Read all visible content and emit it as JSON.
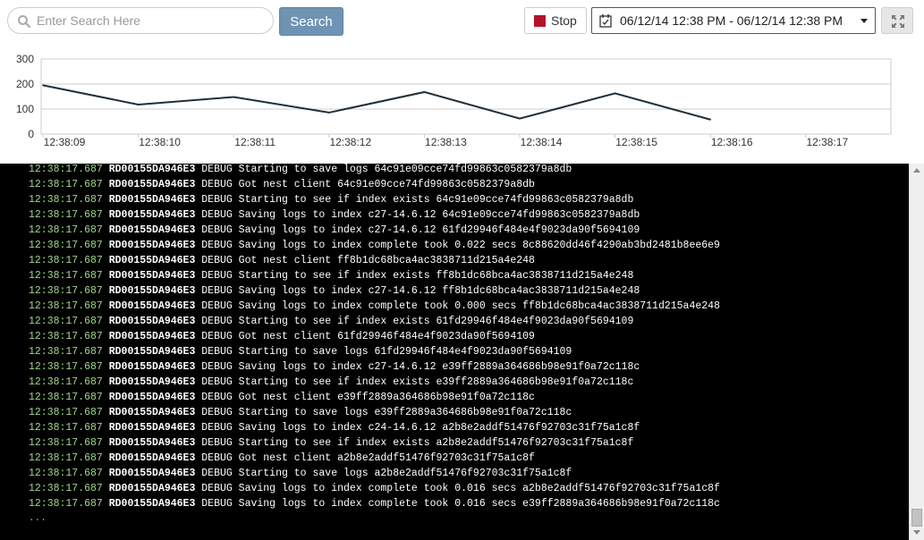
{
  "toolbar": {
    "search_placeholder": "Enter Search Here",
    "search_value": "",
    "search_button_label": "Search",
    "stop_button_label": "Stop",
    "date_range": "06/12/14 12:38 PM - 06/12/14 12:38 PM"
  },
  "colors": {
    "search_button": "#6f93b3",
    "stop_square": "#b5132b",
    "line": "#1f2f3a",
    "timestamp": "#9fd58a",
    "console_bg": "#000000"
  },
  "chart_data": {
    "type": "line",
    "x": [
      "12:38:09",
      "12:38:10",
      "12:38:11",
      "12:38:12",
      "12:38:13",
      "12:38:14",
      "12:38:15",
      "12:38:16"
    ],
    "x_ticks": [
      "12:38:09",
      "12:38:10",
      "12:38:11",
      "12:38:12",
      "12:38:13",
      "12:38:14",
      "12:38:15",
      "12:38:16",
      "12:38:17"
    ],
    "values": [
      195,
      118,
      148,
      86,
      168,
      62,
      163,
      58
    ],
    "ylim": [
      0,
      300
    ],
    "y_ticks": [
      0,
      100,
      200,
      300
    ],
    "grid": true
  },
  "logs": [
    {
      "ts": "12:38:17.687",
      "host": "RD00155DA946E3",
      "msg": "DEBUG Starting to save logs 64c91e09cce74fd99863c0582379a8db"
    },
    {
      "ts": "12:38:17.687",
      "host": "RD00155DA946E3",
      "msg": "DEBUG Got nest client 64c91e09cce74fd99863c0582379a8db"
    },
    {
      "ts": "12:38:17.687",
      "host": "RD00155DA946E3",
      "msg": "DEBUG Starting to see if index exists 64c91e09cce74fd99863c0582379a8db"
    },
    {
      "ts": "12:38:17.687",
      "host": "RD00155DA946E3",
      "msg": "DEBUG Saving logs to index c27-14.6.12 64c91e09cce74fd99863c0582379a8db"
    },
    {
      "ts": "12:38:17.687",
      "host": "RD00155DA946E3",
      "msg": "DEBUG Saving logs to index c27-14.6.12 61fd29946f484e4f9023da90f5694109"
    },
    {
      "ts": "12:38:17.687",
      "host": "RD00155DA946E3",
      "msg": "DEBUG Saving logs to index complete took 0.022 secs 8c88620dd46f4290ab3bd2481b8ee6e9"
    },
    {
      "ts": "12:38:17.687",
      "host": "RD00155DA946E3",
      "msg": "DEBUG Got nest client ff8b1dc68bca4ac3838711d215a4e248"
    },
    {
      "ts": "12:38:17.687",
      "host": "RD00155DA946E3",
      "msg": "DEBUG Starting to see if index exists ff8b1dc68bca4ac3838711d215a4e248"
    },
    {
      "ts": "12:38:17.687",
      "host": "RD00155DA946E3",
      "msg": "DEBUG Saving logs to index c27-14.6.12 ff8b1dc68bca4ac3838711d215a4e248"
    },
    {
      "ts": "12:38:17.687",
      "host": "RD00155DA946E3",
      "msg": "DEBUG Saving logs to index complete took 0.000 secs ff8b1dc68bca4ac3838711d215a4e248"
    },
    {
      "ts": "12:38:17.687",
      "host": "RD00155DA946E3",
      "msg": "DEBUG Starting to see if index exists 61fd29946f484e4f9023da90f5694109"
    },
    {
      "ts": "12:38:17.687",
      "host": "RD00155DA946E3",
      "msg": "DEBUG Got nest client 61fd29946f484e4f9023da90f5694109"
    },
    {
      "ts": "12:38:17.687",
      "host": "RD00155DA946E3",
      "msg": "DEBUG Starting to save logs 61fd29946f484e4f9023da90f5694109"
    },
    {
      "ts": "12:38:17.687",
      "host": "RD00155DA946E3",
      "msg": "DEBUG Saving logs to index c27-14.6.12 e39ff2889a364686b98e91f0a72c118c"
    },
    {
      "ts": "12:38:17.687",
      "host": "RD00155DA946E3",
      "msg": "DEBUG Starting to see if index exists e39ff2889a364686b98e91f0a72c118c"
    },
    {
      "ts": "12:38:17.687",
      "host": "RD00155DA946E3",
      "msg": "DEBUG Got nest client e39ff2889a364686b98e91f0a72c118c"
    },
    {
      "ts": "12:38:17.687",
      "host": "RD00155DA946E3",
      "msg": "DEBUG Starting to save logs e39ff2889a364686b98e91f0a72c118c"
    },
    {
      "ts": "12:38:17.687",
      "host": "RD00155DA946E3",
      "msg": "DEBUG Saving logs to index c24-14.6.12 a2b8e2addf51476f92703c31f75a1c8f"
    },
    {
      "ts": "12:38:17.687",
      "host": "RD00155DA946E3",
      "msg": "DEBUG Starting to see if index exists a2b8e2addf51476f92703c31f75a1c8f"
    },
    {
      "ts": "12:38:17.687",
      "host": "RD00155DA946E3",
      "msg": "DEBUG Got nest client a2b8e2addf51476f92703c31f75a1c8f"
    },
    {
      "ts": "12:38:17.687",
      "host": "RD00155DA946E3",
      "msg": "DEBUG Starting to save logs a2b8e2addf51476f92703c31f75a1c8f"
    },
    {
      "ts": "12:38:17.687",
      "host": "RD00155DA946E3",
      "msg": "DEBUG Saving logs to index complete took 0.016 secs a2b8e2addf51476f92703c31f75a1c8f"
    },
    {
      "ts": "12:38:17.687",
      "host": "RD00155DA946E3",
      "msg": "DEBUG Saving logs to index complete took 0.016 secs e39ff2889a364686b98e91f0a72c118c"
    }
  ],
  "log_more": "..."
}
